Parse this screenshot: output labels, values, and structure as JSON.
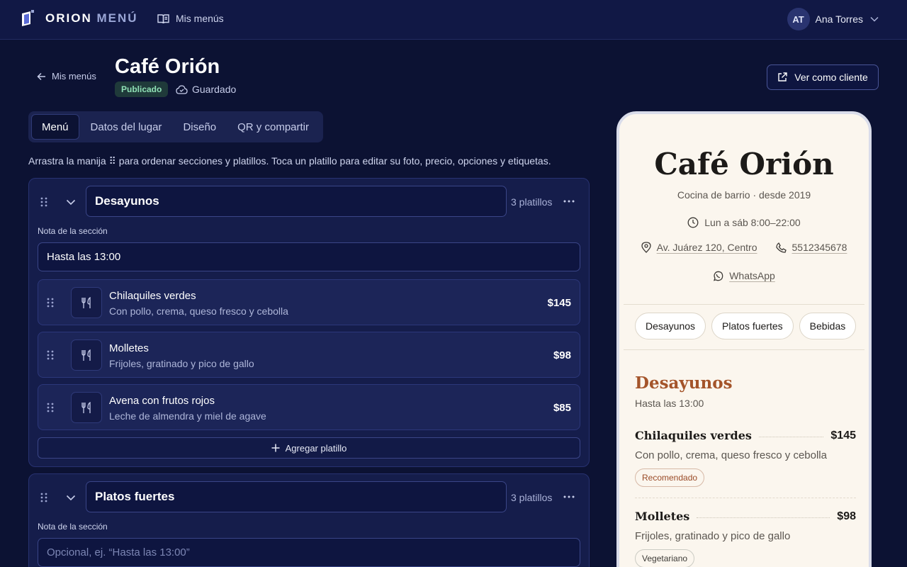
{
  "colors": {
    "background": "#0c1233",
    "topbar": "#111845",
    "card": "#151d4b",
    "preview_bg": "#fbf6ee",
    "preview_accent": "#a4542a",
    "published_text": "#8fe0b5"
  },
  "topbar": {
    "brand_main": "ORION",
    "brand_accent": "MENÚ",
    "nav_link": "Mis menús",
    "user_initials": "AT",
    "user_name": "Ana Torres"
  },
  "header": {
    "back_label": "Mis menús",
    "title": "Café Orión",
    "status_badge": "Publicado",
    "save_status": "Guardado",
    "view_button": "Ver como cliente"
  },
  "tabs": [
    {
      "label": "Menú",
      "active": true
    },
    {
      "label": "Datos del lugar",
      "active": false
    },
    {
      "label": "Diseño",
      "active": false
    },
    {
      "label": "QR y compartir",
      "active": false
    }
  ],
  "hint": "Arrastra la manija ⠿ para ordenar secciones y platillos. Toca un platillo para editar su foto, precio, opciones y etiquetas.",
  "sections": [
    {
      "name": "Desayunos",
      "count": "3 platillos",
      "note_label": "Nota de la sección",
      "note_value": "Hasta las 13:00",
      "dishes": [
        {
          "name": "Chilaquiles verdes",
          "desc": "Con pollo, crema, queso fresco y cebolla",
          "price": "$145"
        },
        {
          "name": "Molletes",
          "desc": "Frijoles, gratinado y pico de gallo",
          "price": "$98"
        },
        {
          "name": "Avena con frutos rojos",
          "desc": "Leche de almendra y miel de agave",
          "price": "$85"
        }
      ],
      "add_label": "Agregar platillo"
    },
    {
      "name": "Platos fuertes",
      "count": "3 platillos",
      "note_label": "Nota de la sección",
      "note_placeholder": "Opcional, ej. “Hasta las 13:00”"
    }
  ],
  "preview": {
    "title": "Café Orión",
    "subtitle": "Cocina de barrio · desde 2019",
    "hours": "Lun a sáb 8:00–22:00",
    "address": "Av. Juárez 120, Centro",
    "phone": "5512345678",
    "whatsapp": "WhatsApp",
    "chips": [
      "Desayunos",
      "Platos fuertes",
      "Bebidas"
    ],
    "section_title": "Desayunos",
    "section_note": "Hasta las 13:00",
    "dishes": [
      {
        "name": "Chilaquiles verdes",
        "price": "$145",
        "desc": "Con pollo, crema, queso fresco y cebolla",
        "tag": "Recomendado"
      },
      {
        "name": "Molletes",
        "price": "$98",
        "desc": "Frijoles, gratinado y pico de gallo",
        "tag": "Vegetariano"
      }
    ]
  },
  "icons": {
    "logo": "orion-logo-icon",
    "nav": "book-open-icon",
    "chevron": "chevron-down-icon",
    "back": "arrow-left-icon",
    "cloud": "cloud-check-icon",
    "external": "external-link-icon",
    "drag": "drag-handle-icon",
    "more": "more-horizontal-icon",
    "utensils": "utensils-icon",
    "plus": "plus-icon",
    "clock": "clock-icon",
    "pin": "map-pin-icon",
    "phone": "phone-icon",
    "whatsapp": "whatsapp-icon"
  }
}
